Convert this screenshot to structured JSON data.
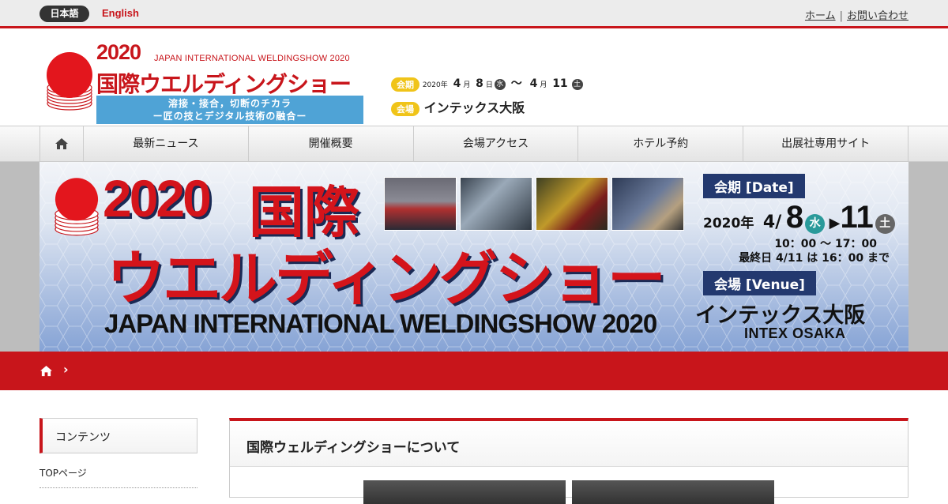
{
  "topbar": {
    "lang_ja": "日本語",
    "lang_en": "English",
    "links": [
      "ホーム",
      "お問い合わせ"
    ],
    "separator": "|"
  },
  "header": {
    "year": "2020",
    "title_en": "JAPAN INTERNATIONAL WELDINGSHOW 2020",
    "title_ja": "国際ウエルディングショー",
    "tagline_1": "溶接・接合，切断のチカラ",
    "tagline_2": "ー匠の技とデジタル技術の融合ー",
    "date_label": "会期",
    "date_year": "2020",
    "nen": "年",
    "tsuki": "月",
    "hi": "日",
    "start_month": "4",
    "start_day": "8",
    "start_weekday": "水",
    "range_sep": "〜",
    "end_month": "4",
    "end_day": "11",
    "end_weekday": "土",
    "venue_label": "会場",
    "venue": "インテックス大阪"
  },
  "nav": {
    "items": [
      "最新ニュース",
      "開催概要",
      "会場アクセス",
      "ホテル予約",
      "出展社専用サイト"
    ]
  },
  "banner": {
    "year": "2020",
    "kokusai": "国際",
    "title": "ウエルディングショー",
    "title_en": "JAPAN INTERNATIONAL WELDINGSHOW 2020",
    "date_label": "会期 [Date]",
    "date_year": "2020",
    "nen": "年",
    "month": "4/",
    "start_day": "8",
    "start_weekday": "水",
    "end_day": "11",
    "end_weekday": "土",
    "time": "10：00 〜 17：00",
    "last_day": "最終日 4/11 は 16：00 まで",
    "venue_label": "会場 [Venue]",
    "venue": "インテックス大阪",
    "venue_en": "INTEX OSAKA"
  },
  "breadcrumb": {
    "separator": "›"
  },
  "sidebar": {
    "heading": "コンテンツ",
    "items": [
      "TOPページ"
    ]
  },
  "main": {
    "heading": "国際ウェルディングショーについて"
  },
  "colors": {
    "brand_red": "#c8151b",
    "navy": "#23396f",
    "tag_blue": "#4fa3d6",
    "pill_yellow": "#f0c419",
    "wed_teal": "#2a9a9a",
    "sat_gray": "#666666"
  }
}
